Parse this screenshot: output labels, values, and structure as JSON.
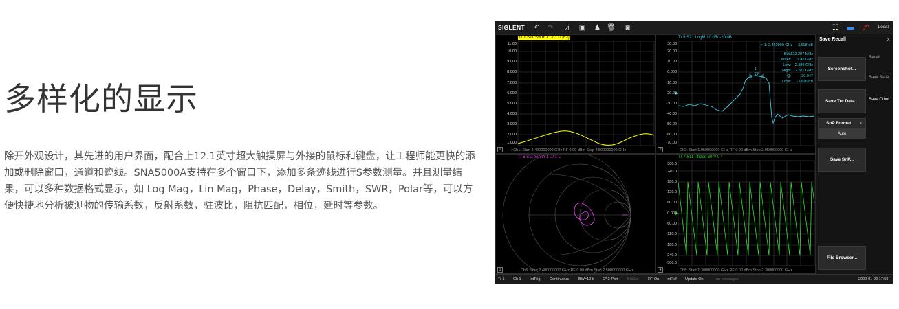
{
  "headline": "多样化的显示",
  "description": "除开外观设计，其先进的用户界面，配合上12.1英寸超大触摸屏与外接的鼠标和键盘，让工程师能更快的添加或删除窗口，通道和迹线。SNA5000A支持在多个窗口下，添加多条迹线进行S参数测量。并且测量结果，可以多种数据格式显示，如 Log Mag，Lin Mag，Phase，Delay，Smith，SWR，Polar等，可以方便快捷地分析被测物的传输系数，反射系数，驻波比，阻抗匹配，相位，延时等参数。",
  "instrument": {
    "logo": "SIGLENT",
    "local": "Local",
    "panels": [
      {
        "title": "Tr 1  S11  SWR  1 U/  1 U [F2]",
        "color": "#ffff00",
        "y_labels": [
          "11.00",
          "10.00",
          "9.000",
          "8.000",
          "7.000",
          "6.000",
          "5.000",
          "4.000",
          "3.000",
          "2.000",
          "1.000"
        ],
        "footer": ">Ch1: Start 2.400000000 GHz    RF 0.00 dBm    Stop 2.500000000 GHz",
        "number": "1"
      },
      {
        "title": "Tr 5  S21  LogM  10 dB/ -20 dB",
        "color": "#40d0e0",
        "y_labels": [
          "30.00",
          "20.00",
          "10.00",
          "0.000",
          "-10.00",
          "-20.00",
          "-30.00",
          "-40.00",
          "-50.00",
          "-60.00",
          "-70.00"
        ],
        "footer": "Ch2: Start 1.950000000 GHz    RF 0.00 dBm    Stop 2.950000000 GHz",
        "number": "2",
        "marker_label": "1",
        "marker": {
          "label": ">  1:  2.450000 GHz",
          "value": "-3.608 dB"
        },
        "stats": [
          {
            "k": "BW:",
            "v": "122.207 MHz"
          },
          {
            "k": "Center:",
            "v": "2.45 GHz"
          },
          {
            "k": "Low:",
            "v": "2.389 GHz"
          },
          {
            "k": "High:",
            "v": "2.511 GHz"
          },
          {
            "k": "Q:",
            "v": "20.047"
          },
          {
            "k": "Loss:",
            "v": "-3.626 dB"
          }
        ]
      },
      {
        "title": "Tr 6  S11  Smith  1 U/  1 U",
        "color": "#e040e0",
        "footer": "Ch3: Start 2.400000000 GHz    RF 0.00 dBm    Stop 2.500000000 GHz",
        "number": "3"
      },
      {
        "title": "Tr 7  S11  Phase  60 °/  0 °",
        "color": "#30e030",
        "y_labels": [
          "300.0",
          "240.0",
          "180.0",
          "120.0",
          "60.00",
          "0.000",
          "-60.00",
          "-120.0",
          "-180.0",
          "-240.0",
          "-300.0"
        ],
        "footer": "Ch8: Start 1.300000000 GHz    RF 0.00 dBm    Stop 2.300000000 GHz",
        "number": "4"
      }
    ],
    "menu": {
      "title": "Save Recall",
      "close": "×",
      "buttons": [
        "Screenshot...",
        "Save Trc Data...",
        "SnP Format",
        "Auto",
        "Save SnP...",
        "File Browser..."
      ],
      "tabs": [
        "Recall",
        "Save State",
        "Save Other"
      ]
    },
    "status": [
      "Tr 1",
      "Ch 1",
      "IntTrig",
      "Continuous",
      "BW=10 k",
      "C* 2-Port",
      "SrcCal",
      "RF On",
      "IntRef",
      "Update On",
      "no messages",
      "2000-01-29 17:59"
    ]
  },
  "colors": {
    "swr": "#ffff00",
    "logmag": "#40d0e0",
    "smith": "#e040e0",
    "phase": "#30e030",
    "grid": "#444444"
  }
}
